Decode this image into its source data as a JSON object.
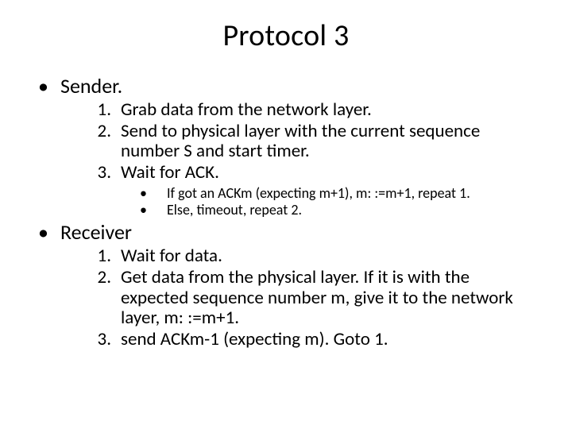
{
  "title": "Protocol 3",
  "senderHeading": "Sender.",
  "senderSteps": [
    "Grab data from the network layer.",
    "Send to physical layer with the current sequence number S and start timer.",
    "Wait for ACK."
  ],
  "senderSub": [
    "If got an ACKm (expecting  m+1), m: :=m+1, repeat 1.",
    "Else, timeout, repeat 2."
  ],
  "receiverHeading": "Receiver",
  "receiverSteps": [
    "Wait for data.",
    "Get data from the physical layer. If it is with the expected sequence number m, give it to the network layer, m: :=m+1.",
    "send ACKm-1 (expecting m). Goto 1."
  ]
}
